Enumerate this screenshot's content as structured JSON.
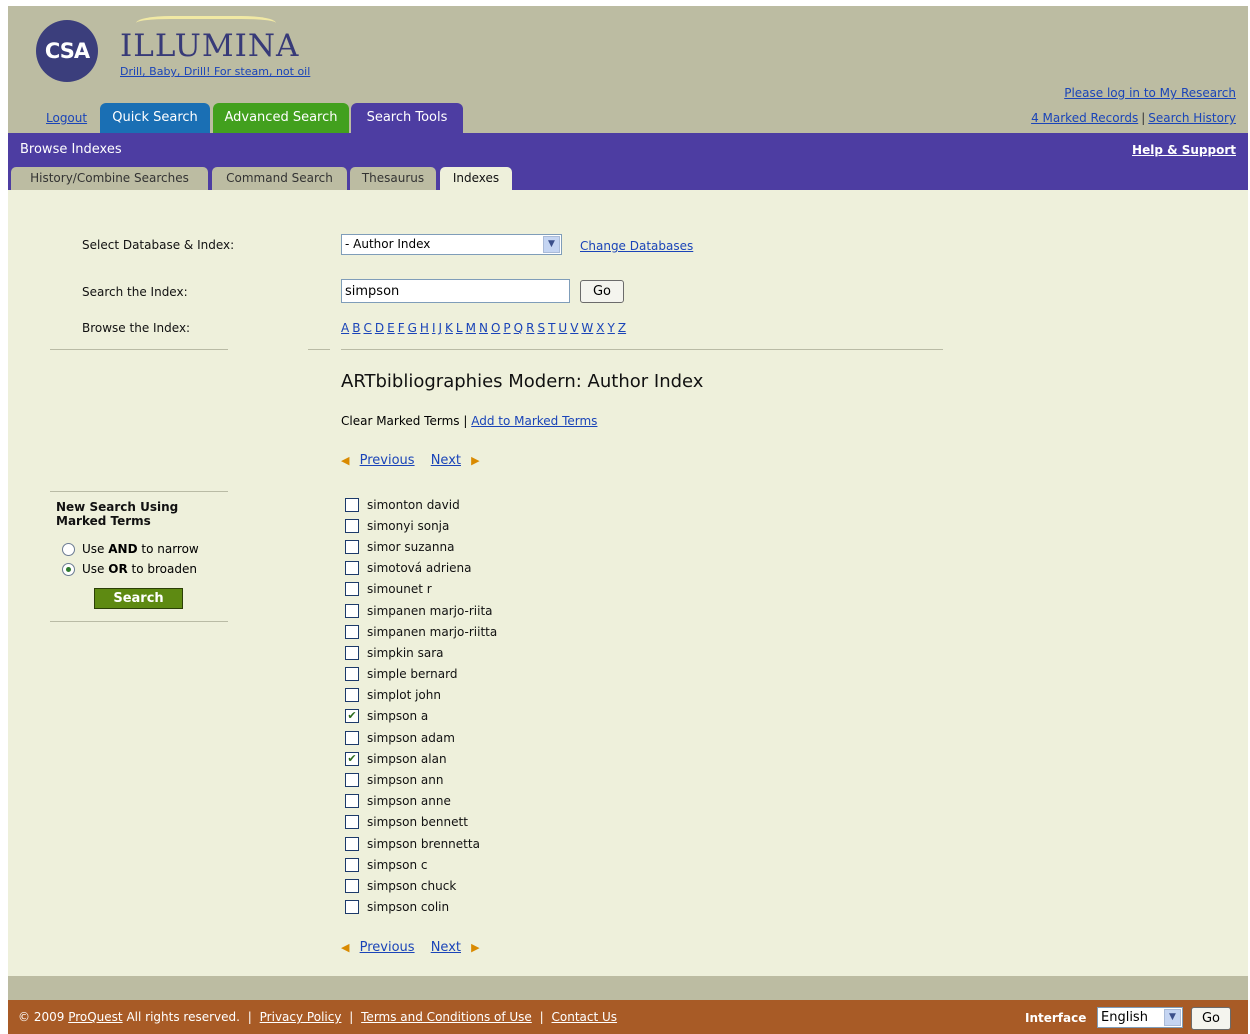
{
  "header": {
    "logo_text": "CSA",
    "app_title": "ILLUMINA",
    "tagline": "Drill, Baby, Drill! For steam, not oil",
    "login_link": "Please log in to My Research",
    "marked_records": "4 Marked Records",
    "separator": "|",
    "search_history": "Search History"
  },
  "main_tabs": {
    "logout": "Logout",
    "quick_search": "Quick Search",
    "advanced_search": "Advanced Search",
    "search_tools": "Search Tools"
  },
  "subbar": {
    "title": "Browse Indexes",
    "help": "Help & Support",
    "tabs": [
      "History/Combine Searches",
      "Command Search",
      "Thesaurus",
      "Indexes"
    ]
  },
  "form": {
    "select_label": "Select Database & Index:",
    "select_value": "- Author Index",
    "change_db": "Change Databases",
    "search_label": "Search the Index:",
    "search_value": "simpson",
    "go": "Go",
    "browse_label": "Browse the Index:",
    "alphabet": [
      "A",
      "B",
      "C",
      "D",
      "E",
      "F",
      "G",
      "H",
      "I",
      "J",
      "K",
      "L",
      "M",
      "N",
      "O",
      "P",
      "Q",
      "R",
      "S",
      "T",
      "U",
      "V",
      "W",
      "X",
      "Y",
      "Z"
    ]
  },
  "index": {
    "title": "ARTbibliographies Modern: Author Index",
    "clear_marked": "Clear Marked Terms",
    "add_marked": "Add to Marked Terms",
    "previous": "Previous",
    "next": "Next",
    "terms": [
      {
        "label": "simonton david",
        "checked": false
      },
      {
        "label": "simonyi sonja",
        "checked": false
      },
      {
        "label": "simor suzanna",
        "checked": false
      },
      {
        "label": "simotová adriena",
        "checked": false
      },
      {
        "label": "simounet r",
        "checked": false
      },
      {
        "label": "simpanen marjo-riita",
        "checked": false
      },
      {
        "label": "simpanen marjo-riitta",
        "checked": false
      },
      {
        "label": "simpkin sara",
        "checked": false
      },
      {
        "label": "simple bernard",
        "checked": false
      },
      {
        "label": "simplot john",
        "checked": false
      },
      {
        "label": "simpson a",
        "checked": true
      },
      {
        "label": "simpson adam",
        "checked": false
      },
      {
        "label": "simpson alan",
        "checked": true
      },
      {
        "label": "simpson ann",
        "checked": false
      },
      {
        "label": "simpson anne",
        "checked": false
      },
      {
        "label": "simpson bennett",
        "checked": false
      },
      {
        "label": "simpson brennetta",
        "checked": false
      },
      {
        "label": "simpson c",
        "checked": false
      },
      {
        "label": "simpson chuck",
        "checked": false
      },
      {
        "label": "simpson colin",
        "checked": false
      }
    ]
  },
  "sidebar": {
    "title_line1": "New Search Using",
    "title_line2": "Marked Terms",
    "use": "Use",
    "and": "AND",
    "and_suffix": "to narrow",
    "or": "OR",
    "or_suffix": "to broaden",
    "search": "Search"
  },
  "footer": {
    "copyright": "© 2009",
    "proquest": "ProQuest",
    "rights": "All rights reserved.",
    "separator": "|",
    "privacy": "Privacy Policy",
    "terms": "Terms and Conditions of Use",
    "contact": "Contact Us",
    "interface_label": "Interface",
    "language": "English",
    "go": "Go"
  },
  "colors": {
    "page_bg": "#bcbca2",
    "content_bg": "#eef0db",
    "purple": "#4d3da2",
    "quick_tab": "#1a6fb4",
    "advanced_tab": "#42a01e",
    "footer": "#a85b26",
    "link": "#1a44b8"
  }
}
